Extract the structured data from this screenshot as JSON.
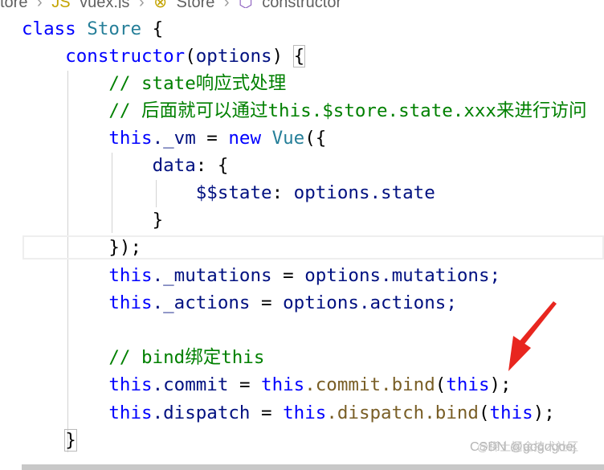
{
  "breadcrumb": {
    "items": [
      "tore",
      "vuex.js",
      "Store",
      "constructor"
    ]
  },
  "code": {
    "lines": [
      [
        "class",
        "Store",
        "{"
      ],
      [
        "constructor",
        "(",
        "options",
        ")",
        "{"
      ],
      [
        "// state响应式处理"
      ],
      [
        "// 后面就可以通过this.$store.state.xxx来进行访问"
      ],
      [
        "this",
        "._vm",
        "=",
        "new",
        "Vue",
        "({"
      ],
      [
        "data",
        ": {"
      ],
      [
        "$$state",
        ": ",
        "options",
        ".state"
      ],
      [
        "}"
      ],
      [
        "});"
      ],
      [
        "this",
        "._mutations",
        "=",
        "options",
        ".mutations;"
      ],
      [
        "this",
        "._actions",
        "=",
        "options",
        ".actions;"
      ],
      [
        ""
      ],
      [
        "// bind绑定this"
      ],
      [
        "this",
        ".commit",
        "=",
        "this",
        ".commit",
        ".bind",
        "(",
        "this",
        ");"
      ],
      [
        "this",
        ".dispatch",
        "=",
        "this",
        ".dispatch",
        ".bind",
        "(",
        "this",
        ");"
      ],
      [
        "}"
      ]
    ]
  },
  "colors": {
    "keyword": "#0000ff",
    "class": "#267f99",
    "function": "#795e26",
    "variable": "#001080",
    "comment": "#008000",
    "arrow": "#e8261f"
  },
  "watermark": "CSDN @gogogoej",
  "watermark_overlay": "@稀土掘金技术社区"
}
